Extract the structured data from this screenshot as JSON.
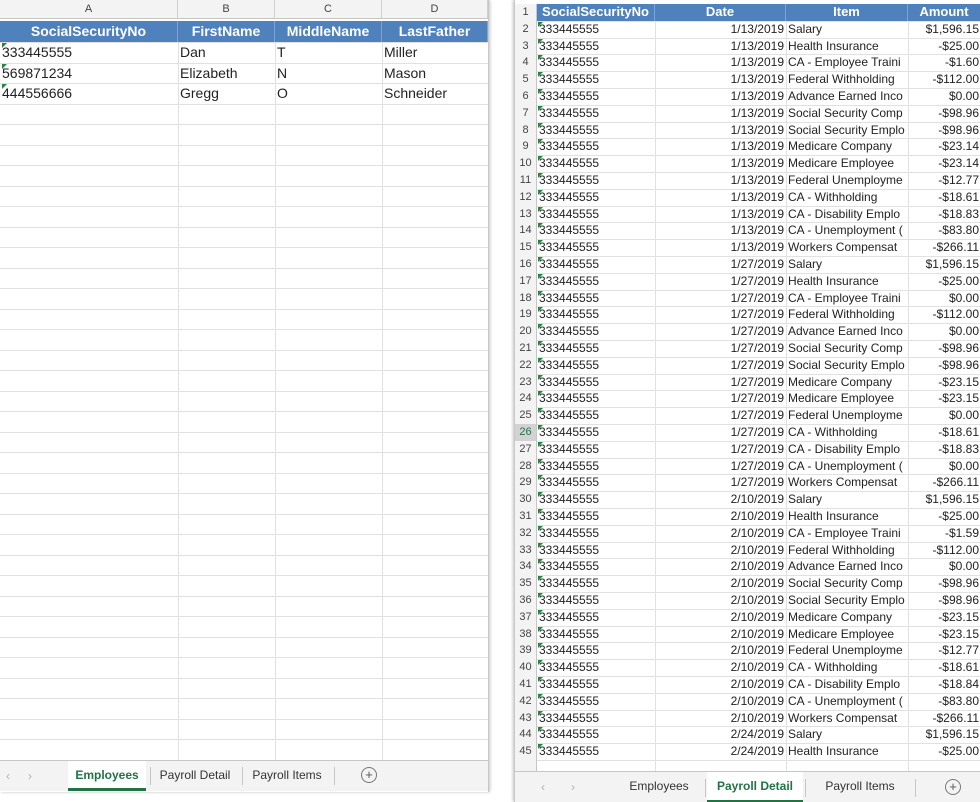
{
  "left": {
    "col_letters": [
      "A",
      "B",
      "C",
      "D"
    ],
    "headers": [
      "SocialSecurityNo",
      "FirstName",
      "MiddleName",
      "LastFather"
    ],
    "rows": [
      [
        "333445555",
        "Dan",
        "T",
        "Miller"
      ],
      [
        "569871234",
        "Elizabeth",
        "N",
        "Mason"
      ],
      [
        "444556666",
        "Gregg",
        "O",
        "Schneider"
      ]
    ],
    "tabs": [
      "Employees",
      "Payroll Detail",
      "Payroll Items"
    ],
    "active_tab": "Employees"
  },
  "right": {
    "headers": [
      "SocialSecurityNo",
      "Date",
      "Item",
      "Amount"
    ],
    "header_row_num": "1",
    "rows": [
      [
        "2",
        "333445555",
        "1/13/2019",
        "Salary",
        "$1,596.15"
      ],
      [
        "3",
        "333445555",
        "1/13/2019",
        "Health Insurance",
        "-$25.00"
      ],
      [
        "4",
        "333445555",
        "1/13/2019",
        "CA - Employee Traini",
        "-$1.60"
      ],
      [
        "5",
        "333445555",
        "1/13/2019",
        "Federal Withholding",
        "-$112.00"
      ],
      [
        "6",
        "333445555",
        "1/13/2019",
        "Advance Earned Inco",
        "$0.00"
      ],
      [
        "7",
        "333445555",
        "1/13/2019",
        "Social Security Comp",
        "-$98.96"
      ],
      [
        "8",
        "333445555",
        "1/13/2019",
        "Social Security Emplo",
        "-$98.96"
      ],
      [
        "9",
        "333445555",
        "1/13/2019",
        "Medicare Company",
        "-$23.14"
      ],
      [
        "10",
        "333445555",
        "1/13/2019",
        "Medicare Employee",
        "-$23.14"
      ],
      [
        "11",
        "333445555",
        "1/13/2019",
        "Federal Unemployme",
        "-$12.77"
      ],
      [
        "12",
        "333445555",
        "1/13/2019",
        "CA - Withholding",
        "-$18.61"
      ],
      [
        "13",
        "333445555",
        "1/13/2019",
        "CA - Disability Emplo",
        "-$18.83"
      ],
      [
        "14",
        "333445555",
        "1/13/2019",
        "CA - Unemployment (",
        "-$83.80"
      ],
      [
        "15",
        "333445555",
        "1/13/2019",
        "Workers Compensat",
        "-$266.11"
      ],
      [
        "16",
        "333445555",
        "1/27/2019",
        "Salary",
        "$1,596.15"
      ],
      [
        "17",
        "333445555",
        "1/27/2019",
        "Health Insurance",
        "-$25.00"
      ],
      [
        "18",
        "333445555",
        "1/27/2019",
        "CA - Employee Traini",
        "$0.00"
      ],
      [
        "19",
        "333445555",
        "1/27/2019",
        "Federal Withholding",
        "-$112.00"
      ],
      [
        "20",
        "333445555",
        "1/27/2019",
        "Advance Earned Inco",
        "$0.00"
      ],
      [
        "21",
        "333445555",
        "1/27/2019",
        "Social Security Comp",
        "-$98.96"
      ],
      [
        "22",
        "333445555",
        "1/27/2019",
        "Social Security Emplo",
        "-$98.96"
      ],
      [
        "23",
        "333445555",
        "1/27/2019",
        "Medicare Company",
        "-$23.15"
      ],
      [
        "24",
        "333445555",
        "1/27/2019",
        "Medicare Employee",
        "-$23.15"
      ],
      [
        "25",
        "333445555",
        "1/27/2019",
        "Federal Unemployme",
        "$0.00"
      ],
      [
        "26",
        "333445555",
        "1/27/2019",
        "CA - Withholding",
        "-$18.61"
      ],
      [
        "27",
        "333445555",
        "1/27/2019",
        "CA - Disability Emplo",
        "-$18.83"
      ],
      [
        "28",
        "333445555",
        "1/27/2019",
        "CA - Unemployment (",
        "$0.00"
      ],
      [
        "29",
        "333445555",
        "1/27/2019",
        "Workers Compensat",
        "-$266.11"
      ],
      [
        "30",
        "333445555",
        "2/10/2019",
        "Salary",
        "$1,596.15"
      ],
      [
        "31",
        "333445555",
        "2/10/2019",
        "Health Insurance",
        "-$25.00"
      ],
      [
        "32",
        "333445555",
        "2/10/2019",
        "CA - Employee Traini",
        "-$1.59"
      ],
      [
        "33",
        "333445555",
        "2/10/2019",
        "Federal Withholding",
        "-$112.00"
      ],
      [
        "34",
        "333445555",
        "2/10/2019",
        "Advance Earned Inco",
        "$0.00"
      ],
      [
        "35",
        "333445555",
        "2/10/2019",
        "Social Security Comp",
        "-$98.96"
      ],
      [
        "36",
        "333445555",
        "2/10/2019",
        "Social Security Emplo",
        "-$98.96"
      ],
      [
        "37",
        "333445555",
        "2/10/2019",
        "Medicare Company",
        "-$23.15"
      ],
      [
        "38",
        "333445555",
        "2/10/2019",
        "Medicare Employee",
        "-$23.15"
      ],
      [
        "39",
        "333445555",
        "2/10/2019",
        "Federal Unemployme",
        "-$12.77"
      ],
      [
        "40",
        "333445555",
        "2/10/2019",
        "CA - Withholding",
        "-$18.61"
      ],
      [
        "41",
        "333445555",
        "2/10/2019",
        "CA - Disability Emplo",
        "-$18.84"
      ],
      [
        "42",
        "333445555",
        "2/10/2019",
        "CA - Unemployment (",
        "-$83.80"
      ],
      [
        "43",
        "333445555",
        "2/10/2019",
        "Workers Compensat",
        "-$266.11"
      ],
      [
        "44",
        "333445555",
        "2/24/2019",
        "Salary",
        "$1,596.15"
      ],
      [
        "45",
        "333445555",
        "2/24/2019",
        "Health Insurance",
        "-$25.00"
      ]
    ],
    "tabs": [
      "Employees",
      "Payroll Detail",
      "Payroll Items"
    ],
    "active_tab": "Payroll Detail",
    "selected_row": "26"
  },
  "colors": {
    "header_blue": "#4f81bd",
    "active_tab_green": "#217346",
    "error_indicator": "#1e8a3a"
  }
}
